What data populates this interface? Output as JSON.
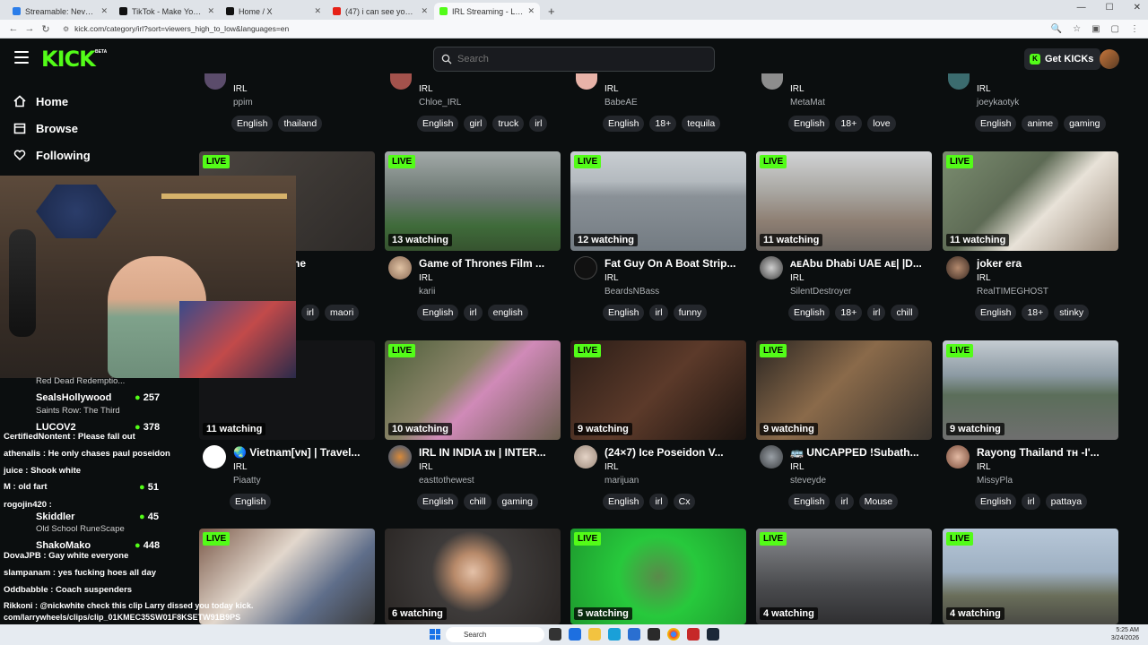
{
  "browser": {
    "tabs": [
      {
        "title": "Streamable: Never IRL Stream",
        "color": "#2b7de9"
      },
      {
        "title": "TikTok - Make Your Day",
        "color": "#111"
      },
      {
        "title": "Home / X",
        "color": "#111"
      },
      {
        "title": "(47) i can see your voice seaso",
        "color": "#e62117"
      },
      {
        "title": "IRL Streaming - Live Streams or",
        "color": "#53fc18",
        "active": true
      }
    ],
    "url": "kick.com/category/irl?sort=viewers_high_to_low&languages=en"
  },
  "header": {
    "logo": "KICK",
    "beta": "BETA",
    "search_placeholder": "Search",
    "get_kicks": "Get KICKs"
  },
  "sidebar": {
    "items": [
      {
        "label": "Home",
        "icon": "home-icon"
      },
      {
        "label": "Browse",
        "icon": "browse-icon"
      },
      {
        "label": "Following",
        "icon": "heart-icon"
      }
    ]
  },
  "top_row": [
    {
      "category": "IRL",
      "streamer": "ppim",
      "tags": [
        "English",
        "thailand"
      ]
    },
    {
      "category": "IRL",
      "streamer": "Chloe_IRL",
      "tags": [
        "English",
        "girl",
        "truck",
        "irl"
      ]
    },
    {
      "category": "IRL",
      "streamer": "BabeAE",
      "tags": [
        "English",
        "18+",
        "tequila"
      ]
    },
    {
      "category": "IRL",
      "streamer": "MetaMat",
      "tags": [
        "English",
        "18+",
        "love"
      ]
    },
    {
      "category": "IRL",
      "streamer": "joeykaotyk",
      "tags": [
        "English",
        "anime",
        "gaming"
      ]
    }
  ],
  "row1": [
    {
      "live": "LIVE",
      "watching": "",
      "title": "ne",
      "category": "",
      "streamer": "",
      "tags": [
        "e",
        "irl",
        "maori"
      ]
    },
    {
      "live": "LIVE",
      "watching": "13 watching",
      "title": "Game of Thrones Film ...",
      "category": "IRL",
      "streamer": "karii",
      "tags": [
        "English",
        "irl",
        "english"
      ]
    },
    {
      "live": "LIVE",
      "watching": "12 watching",
      "title": "Fat Guy On A Boat Strip...",
      "category": "IRL",
      "streamer": "BeardsNBass",
      "tags": [
        "English",
        "irl",
        "funny"
      ]
    },
    {
      "live": "LIVE",
      "watching": "11 watching",
      "title": "ᴀᴇAbu Dhabi UAE ᴀᴇ| |D...",
      "category": "IRL",
      "streamer": "SilentDestroyer",
      "tags": [
        "English",
        "18+",
        "irl",
        "chill"
      ]
    },
    {
      "live": "LIVE",
      "watching": "11 watching",
      "title": "joker era",
      "category": "IRL",
      "streamer": "RealTIMEGHOST",
      "tags": [
        "English",
        "18+",
        "stinky"
      ]
    }
  ],
  "row2": [
    {
      "live": "",
      "watching": "11 watching",
      "title": "🌏 Vietnam[ᴠɴ] | Travel...",
      "category": "IRL",
      "streamer": "Piaatty",
      "tags": [
        "English"
      ]
    },
    {
      "live": "LIVE",
      "watching": "10 watching",
      "title": "IRL IN INDIA ɪɴ | INTER...",
      "category": "IRL",
      "streamer": "easttothewest",
      "tags": [
        "English",
        "chill",
        "gaming"
      ]
    },
    {
      "live": "LIVE",
      "watching": "9 watching",
      "title": "(24×7) Ice Poseidon V...",
      "category": "IRL",
      "streamer": "marijuan",
      "tags": [
        "English",
        "irl",
        "Cx"
      ]
    },
    {
      "live": "LIVE",
      "watching": "9 watching",
      "title": "🚌 UNCAPPED !Subath...",
      "category": "IRL",
      "streamer": "steveyde",
      "tags": [
        "English",
        "irl",
        "Mouse"
      ]
    },
    {
      "live": "LIVE",
      "watching": "9 watching",
      "title": "Rayong Thailand ᴛʜ -I'...",
      "category": "IRL",
      "streamer": "MissyPla",
      "tags": [
        "English",
        "irl",
        "pattaya"
      ]
    }
  ],
  "row3": [
    {
      "live": "LIVE",
      "watching": ""
    },
    {
      "live": "",
      "watching": "6 watching"
    },
    {
      "live": "LIVE",
      "watching": "5 watching"
    },
    {
      "live": "LIVE",
      "watching": "4 watching"
    },
    {
      "live": "LIVE",
      "watching": "4 watching"
    }
  ],
  "thumb_colors": {
    "row1": [
      "#3a3531",
      "#5d6b63",
      "#8e959a",
      "#8e8a84",
      "#5b6b57"
    ],
    "row2": [
      "#141416",
      "#6b6245",
      "#3a2a22",
      "#4a4038",
      "#6f7a79"
    ],
    "row3": [
      "#6f6c70",
      "#4a3a33",
      "#2fd14a",
      "#55565a",
      "#7b8a9a"
    ]
  },
  "chat": [
    {
      "text": "Red Dead Redemptio...",
      "color": "#cfcfcf"
    },
    {
      "text": "SealsHollywood",
      "color": "#ffffff",
      "count": "257"
    },
    {
      "text": "Saints Row: The Third",
      "color": "#cfcfcf"
    },
    {
      "text": "LUCOV2",
      "color": "#ffffff",
      "count": "378"
    },
    {
      "text": "CertifiedNontent : Please fall out",
      "color": "#ffffff"
    },
    {
      "text": "athenalis : He only chases paul poseidon",
      "color": "#ffffff"
    },
    {
      "text": "juice : Shook white",
      "color": "#ffffff"
    },
    {
      "text": "M : old fart",
      "color": "#ffffff",
      "count": "51"
    },
    {
      "text": "rogojin420 :",
      "color": "#ffffff"
    },
    {
      "text": "Skiddler",
      "color": "#ffffff",
      "count": "45"
    },
    {
      "text": "Old School RuneScape",
      "color": "#cfcfcf"
    },
    {
      "text": "ShakoMako",
      "color": "#ffffff",
      "count": "448"
    },
    {
      "text": "DovaJPB : Gay white everyone",
      "color": "#ffffff"
    },
    {
      "text": "slampanam : yes fucking hoes all day",
      "color": "#ffffff"
    },
    {
      "text": "Oddbabble : Coach suspenders",
      "color": "#ffffff"
    },
    {
      "text": "Rikkoni : @nickwhite check this clip Larry dissed you today kick.",
      "color": "#ffffff"
    },
    {
      "text": "com/larrywheels/clips/clip_01KMEC35SW01F8KSETW91B9PS",
      "color": "#ffffff"
    }
  ],
  "taskbar": {
    "search": "Search",
    "time": "5:25 AM",
    "date": "3/24/2026"
  }
}
